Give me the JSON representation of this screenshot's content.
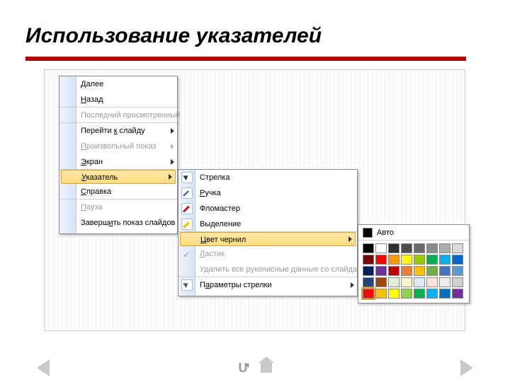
{
  "slide": {
    "title": "Использование указателей"
  },
  "mainMenu": {
    "items": [
      {
        "label": "Далее",
        "hotkeyIndex": 0
      },
      {
        "label": "Назад",
        "hotkeyIndex": 0,
        "sepAfter": true
      },
      {
        "label": "Последний просмотренный",
        "disabled": true,
        "sepAfter": true
      },
      {
        "label": "Перейти к слайду",
        "hotkeyIndex": 8,
        "submenu": true
      },
      {
        "label": "Произвольный показ",
        "hotkeyIndex": 0,
        "submenu": true,
        "disabled": true
      },
      {
        "label": "Экран",
        "hotkeyIndex": 0,
        "submenu": true,
        "sepAfter": true
      },
      {
        "label": "Указатель",
        "hotkeyIndex": 0,
        "submenu": true,
        "hover": true
      },
      {
        "label": "Справка",
        "hotkeyIndex": 0,
        "sepAfter": true
      },
      {
        "label": "Пауза",
        "hotkeyIndex": 0,
        "disabled": true
      },
      {
        "label": "Завершить показ слайдов",
        "hotkeyIndex": 6
      }
    ]
  },
  "pointerMenu": {
    "items": [
      {
        "label": "Стрелка",
        "icon": "arrow-cursor"
      },
      {
        "label": "Ручка",
        "hotkeyIndex": 0,
        "icon": "pen"
      },
      {
        "label": "Фломастер",
        "icon": "marker"
      },
      {
        "label": "Выделение",
        "icon": "highlight",
        "sepAfter": true
      },
      {
        "label": "Цвет чернил",
        "hotkeyIndex": 0,
        "submenu": true,
        "hover": true
      },
      {
        "label": "Ластик",
        "hotkeyIndex": 0,
        "disabled": true,
        "icon": "check"
      },
      {
        "label": "Удалить все рукописные данные со слайда",
        "disabled": true,
        "sepAfter": true
      },
      {
        "label": "Параметры стрелки",
        "hotkeyIndex": 1,
        "submenu": true,
        "icon": "cursoropts"
      }
    ]
  },
  "colorPicker": {
    "autoLabel": "Авто",
    "selectedIndex": 32,
    "colors": [
      "#000000",
      "#ffffff",
      "#2f2f2f",
      "#4b4b4b",
      "#6b6b6b",
      "#8b8b8b",
      "#adadad",
      "#d9d9d9",
      "#7f0000",
      "#ff0000",
      "#ff9900",
      "#ffff00",
      "#99cc00",
      "#00b050",
      "#00b0f0",
      "#0066cc",
      "#002060",
      "#7030a0",
      "#c00000",
      "#ed7d31",
      "#ffc000",
      "#70ad47",
      "#4472c4",
      "#5b9bd5",
      "#264478",
      "#9e480e",
      "#e2efda",
      "#fff2cc",
      "#deebf7",
      "#fbe5d6",
      "#ededed",
      "#d0cece",
      "#ff0000",
      "#ffc000",
      "#ffff00",
      "#92d050",
      "#00b050",
      "#00b0f0",
      "#0070c0",
      "#7030a0"
    ]
  }
}
